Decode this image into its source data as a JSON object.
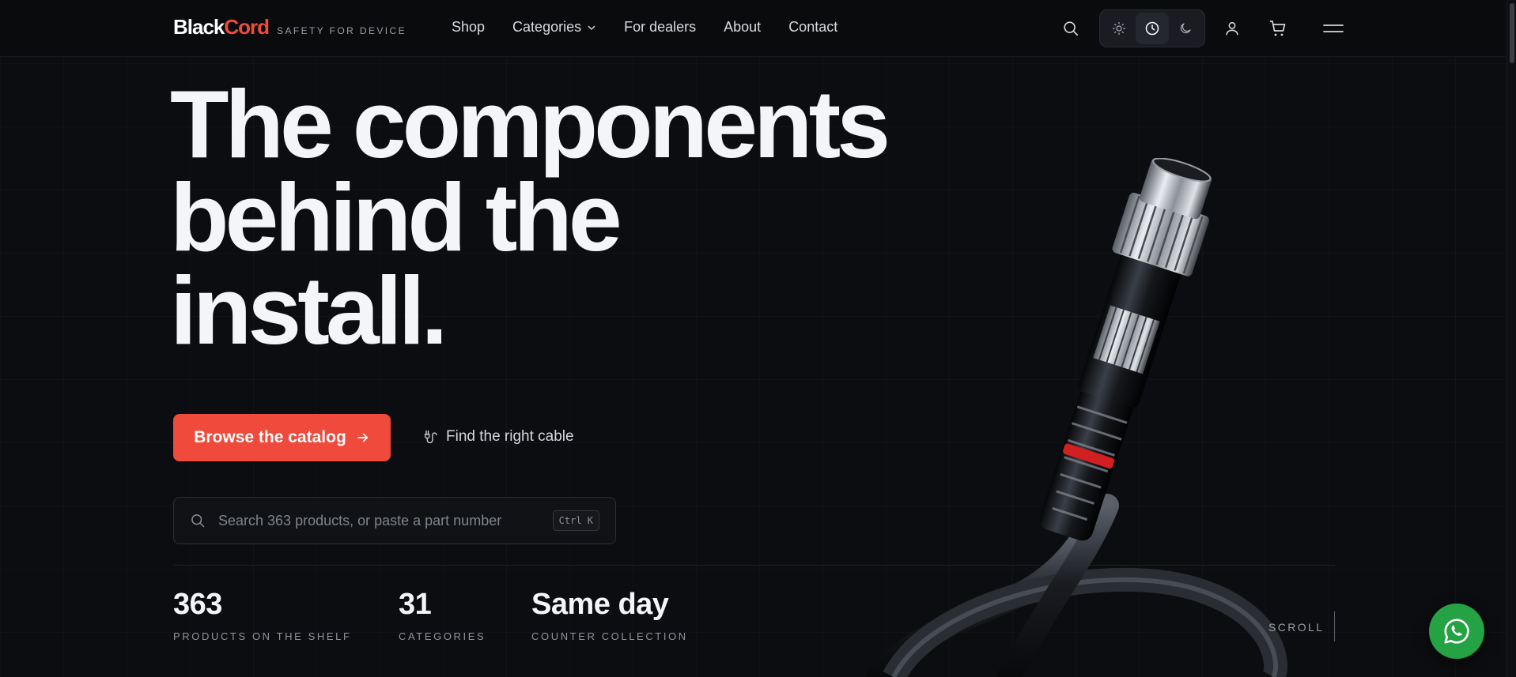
{
  "header": {
    "logo_part1": "Black",
    "logo_part2": "Cord",
    "tagline": "SAFETY FOR DEVICE",
    "nav": [
      "Shop",
      "Categories",
      "For dealers",
      "About",
      "Contact"
    ],
    "icons": [
      "search-icon",
      "sun-icon",
      "clock-icon",
      "moon-icon",
      "user-icon",
      "cart-icon",
      "menu-icon"
    ]
  },
  "hero": {
    "title_lines": [
      "The components",
      "behind the",
      "install."
    ],
    "cta_label": "Browse the catalog",
    "secondary_label": "Find the right cable"
  },
  "search": {
    "placeholder": "Search 363 products, or paste a part number",
    "shortcut": "Ctrl K"
  },
  "stats": [
    {
      "value": "363",
      "label": "PRODUCTS ON THE SHELF"
    },
    {
      "value": "31",
      "label": "CATEGORIES"
    },
    {
      "value": "Same day",
      "label": "COUNTER COLLECTION"
    }
  ],
  "scroll_label": "SCROLL",
  "colors": {
    "accent": "#ef4a3b",
    "background": "#0c0d10",
    "whatsapp": "#25a244"
  }
}
